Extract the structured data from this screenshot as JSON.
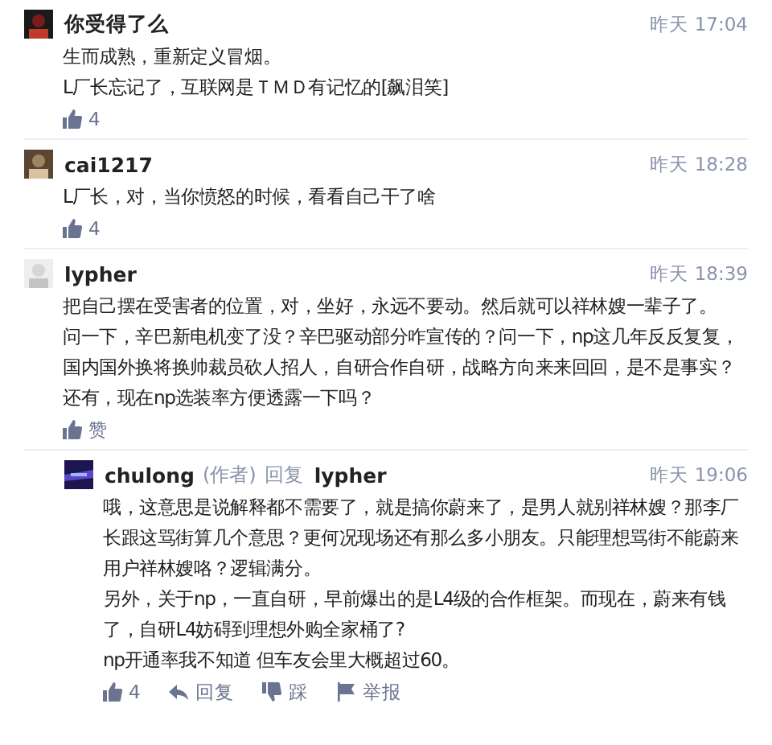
{
  "comments": [
    {
      "author": "你受得了么",
      "time": "昨天 17:04",
      "paragraphs": [
        "生而成熟，重新定义冒烟。",
        "L厂长忘记了，互联网是ＴＭＤ有记忆的[飙泪笑]"
      ],
      "actions": [
        {
          "kind": "like",
          "label": "4"
        }
      ]
    },
    {
      "author": "cai1217",
      "time": "昨天 18:28",
      "paragraphs": [
        "L厂长，对，当你愤怒的时候，看看自己干了啥"
      ],
      "actions": [
        {
          "kind": "like",
          "label": "4"
        }
      ]
    },
    {
      "author": "lypher",
      "time": "昨天 18:39",
      "paragraphs": [
        "把自己摆在受害者的位置，对，坐好，永远不要动。然后就可以祥林嫂一辈子了。",
        "问一下，辛巴新电机变了没？辛巴驱动部分咋宣传的？问一下，np这几年反反复复，国内国外换将换帅裁员砍人招人，自研合作自研，战略方向来来回回，是不是事实？还有，现在np选装率方便透露一下吗？"
      ],
      "actions": [
        {
          "kind": "like",
          "label": "赞"
        }
      ],
      "replies": [
        {
          "author": "chulong",
          "author_tag": "(作者)",
          "reply_word": "回复",
          "reply_to": "lypher",
          "time": "昨天 19:06",
          "paragraphs": [
            "哦，这意思是说解释都不需要了，就是搞你蔚来了，是男人就别祥林嫂？那李厂长跟这骂街算几个意思？更何况现场还有那么多小朋友。只能理想骂街不能蔚来用户祥林嫂咯？逻辑满分。",
            "另外，关于np，一直自研，早前爆出的是L4级的合作框架。而现在，蔚来有钱了，自研L4妨碍到理想外购全家桶了?",
            "np开通率我不知道 但车友会里大概超过60。"
          ],
          "actions": [
            {
              "kind": "like",
              "label": "4"
            },
            {
              "kind": "reply",
              "label": "回复"
            },
            {
              "kind": "dislike",
              "label": "踩"
            },
            {
              "kind": "report",
              "label": "举报"
            }
          ]
        }
      ]
    }
  ]
}
